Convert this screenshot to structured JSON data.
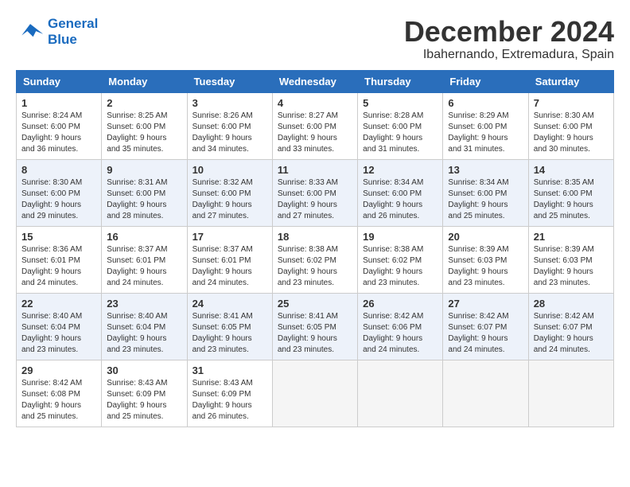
{
  "logo": {
    "line1": "General",
    "line2": "Blue"
  },
  "title": "December 2024",
  "location": "Ibahernando, Extremadura, Spain",
  "days_of_week": [
    "Sunday",
    "Monday",
    "Tuesday",
    "Wednesday",
    "Thursday",
    "Friday",
    "Saturday"
  ],
  "weeks": [
    [
      {
        "day": "1",
        "sunrise": "8:24 AM",
        "sunset": "6:00 PM",
        "daylight": "9 hours and 36 minutes."
      },
      {
        "day": "2",
        "sunrise": "8:25 AM",
        "sunset": "6:00 PM",
        "daylight": "9 hours and 35 minutes."
      },
      {
        "day": "3",
        "sunrise": "8:26 AM",
        "sunset": "6:00 PM",
        "daylight": "9 hours and 34 minutes."
      },
      {
        "day": "4",
        "sunrise": "8:27 AM",
        "sunset": "6:00 PM",
        "daylight": "9 hours and 33 minutes."
      },
      {
        "day": "5",
        "sunrise": "8:28 AM",
        "sunset": "6:00 PM",
        "daylight": "9 hours and 31 minutes."
      },
      {
        "day": "6",
        "sunrise": "8:29 AM",
        "sunset": "6:00 PM",
        "daylight": "9 hours and 31 minutes."
      },
      {
        "day": "7",
        "sunrise": "8:30 AM",
        "sunset": "6:00 PM",
        "daylight": "9 hours and 30 minutes."
      }
    ],
    [
      {
        "day": "8",
        "sunrise": "8:30 AM",
        "sunset": "6:00 PM",
        "daylight": "9 hours and 29 minutes."
      },
      {
        "day": "9",
        "sunrise": "8:31 AM",
        "sunset": "6:00 PM",
        "daylight": "9 hours and 28 minutes."
      },
      {
        "day": "10",
        "sunrise": "8:32 AM",
        "sunset": "6:00 PM",
        "daylight": "9 hours and 27 minutes."
      },
      {
        "day": "11",
        "sunrise": "8:33 AM",
        "sunset": "6:00 PM",
        "daylight": "9 hours and 27 minutes."
      },
      {
        "day": "12",
        "sunrise": "8:34 AM",
        "sunset": "6:00 PM",
        "daylight": "9 hours and 26 minutes."
      },
      {
        "day": "13",
        "sunrise": "8:34 AM",
        "sunset": "6:00 PM",
        "daylight": "9 hours and 25 minutes."
      },
      {
        "day": "14",
        "sunrise": "8:35 AM",
        "sunset": "6:00 PM",
        "daylight": "9 hours and 25 minutes."
      }
    ],
    [
      {
        "day": "15",
        "sunrise": "8:36 AM",
        "sunset": "6:01 PM",
        "daylight": "9 hours and 24 minutes."
      },
      {
        "day": "16",
        "sunrise": "8:37 AM",
        "sunset": "6:01 PM",
        "daylight": "9 hours and 24 minutes."
      },
      {
        "day": "17",
        "sunrise": "8:37 AM",
        "sunset": "6:01 PM",
        "daylight": "9 hours and 24 minutes."
      },
      {
        "day": "18",
        "sunrise": "8:38 AM",
        "sunset": "6:02 PM",
        "daylight": "9 hours and 23 minutes."
      },
      {
        "day": "19",
        "sunrise": "8:38 AM",
        "sunset": "6:02 PM",
        "daylight": "9 hours and 23 minutes."
      },
      {
        "day": "20",
        "sunrise": "8:39 AM",
        "sunset": "6:03 PM",
        "daylight": "9 hours and 23 minutes."
      },
      {
        "day": "21",
        "sunrise": "8:39 AM",
        "sunset": "6:03 PM",
        "daylight": "9 hours and 23 minutes."
      }
    ],
    [
      {
        "day": "22",
        "sunrise": "8:40 AM",
        "sunset": "6:04 PM",
        "daylight": "9 hours and 23 minutes."
      },
      {
        "day": "23",
        "sunrise": "8:40 AM",
        "sunset": "6:04 PM",
        "daylight": "9 hours and 23 minutes."
      },
      {
        "day": "24",
        "sunrise": "8:41 AM",
        "sunset": "6:05 PM",
        "daylight": "9 hours and 23 minutes."
      },
      {
        "day": "25",
        "sunrise": "8:41 AM",
        "sunset": "6:05 PM",
        "daylight": "9 hours and 23 minutes."
      },
      {
        "day": "26",
        "sunrise": "8:42 AM",
        "sunset": "6:06 PM",
        "daylight": "9 hours and 24 minutes."
      },
      {
        "day": "27",
        "sunrise": "8:42 AM",
        "sunset": "6:07 PM",
        "daylight": "9 hours and 24 minutes."
      },
      {
        "day": "28",
        "sunrise": "8:42 AM",
        "sunset": "6:07 PM",
        "daylight": "9 hours and 24 minutes."
      }
    ],
    [
      {
        "day": "29",
        "sunrise": "8:42 AM",
        "sunset": "6:08 PM",
        "daylight": "9 hours and 25 minutes."
      },
      {
        "day": "30",
        "sunrise": "8:43 AM",
        "sunset": "6:09 PM",
        "daylight": "9 hours and 25 minutes."
      },
      {
        "day": "31",
        "sunrise": "8:43 AM",
        "sunset": "6:09 PM",
        "daylight": "9 hours and 26 minutes."
      },
      null,
      null,
      null,
      null
    ]
  ],
  "labels": {
    "sunrise": "Sunrise: ",
    "sunset": "Sunset: ",
    "daylight": "Daylight: "
  }
}
